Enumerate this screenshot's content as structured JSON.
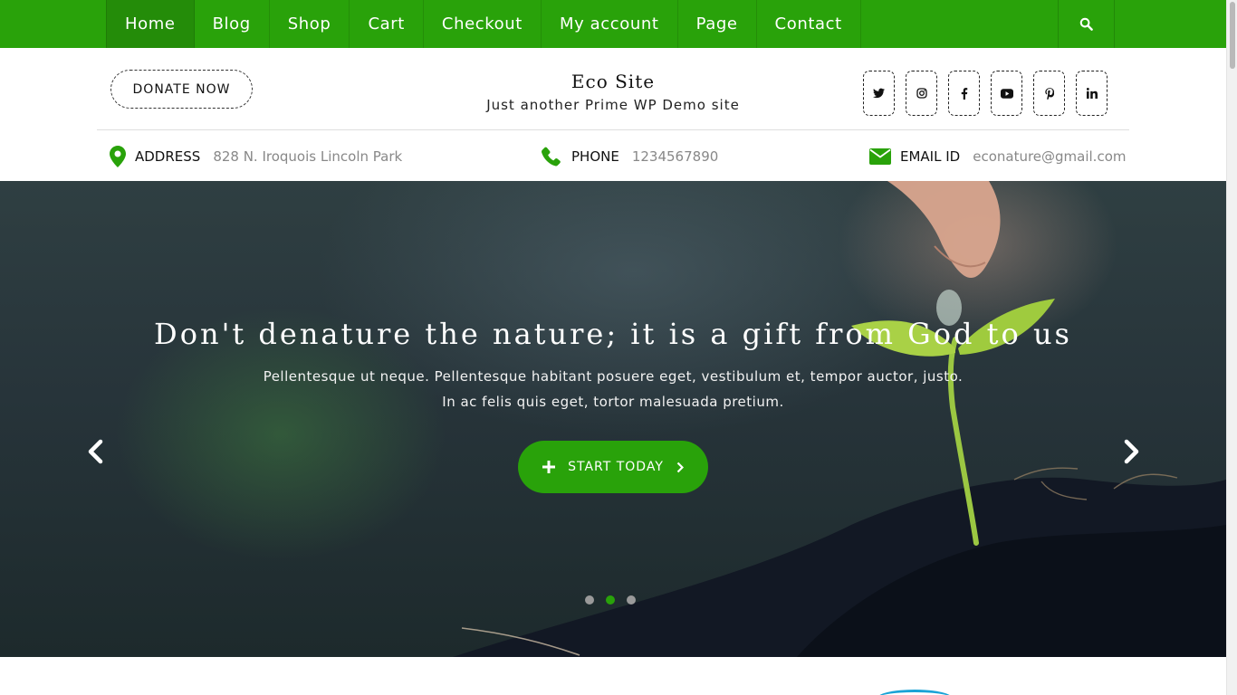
{
  "nav": {
    "items": [
      {
        "label": "Home",
        "active": true
      },
      {
        "label": "Blog"
      },
      {
        "label": "Shop"
      },
      {
        "label": "Cart"
      },
      {
        "label": "Checkout"
      },
      {
        "label": "My account"
      },
      {
        "label": "Page"
      },
      {
        "label": "Contact"
      }
    ],
    "search_icon": "search-icon"
  },
  "header": {
    "donate_label": "DONATE NOW",
    "site_title": "Eco Site",
    "tagline": "Just another Prime WP Demo site",
    "socials": [
      "twitter-icon",
      "instagram-icon",
      "facebook-icon",
      "youtube-icon",
      "pinterest-icon",
      "linkedin-icon"
    ]
  },
  "contact": {
    "address": {
      "label": "ADDRESS",
      "value": "828 N. Iroquois Lincoln Park"
    },
    "phone": {
      "label": "PHONE",
      "value": "1234567890"
    },
    "email": {
      "label": "EMAIL ID",
      "value": "econature@gmail.com"
    }
  },
  "hero": {
    "title": "Don't denature the nature; it is a gift from God to us",
    "text": "Pellentesque ut neque. Pellentesque habitant posuere eget, vestibulum et, tempor auctor, justo. In ac felis quis eget, tortor malesuada pretium.",
    "cta_label": "START TODAY",
    "slides": 3,
    "active_slide": 2
  },
  "colors": {
    "brand_green": "#29a20a",
    "nav_active": "#248c09",
    "text_muted": "#888888"
  }
}
